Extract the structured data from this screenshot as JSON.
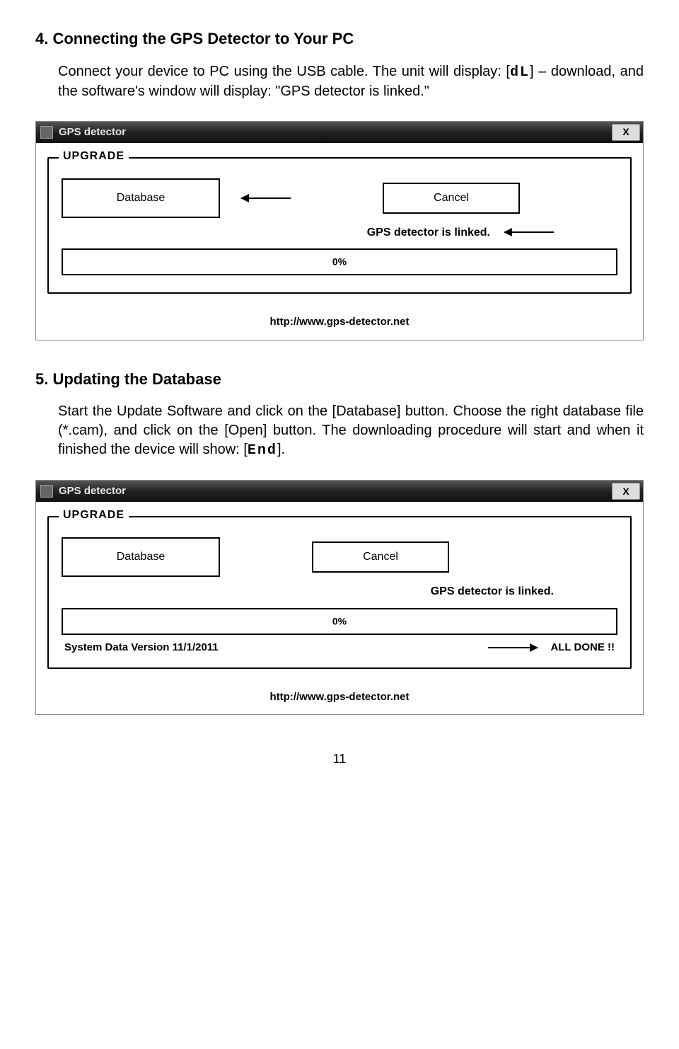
{
  "section4": {
    "title": "4. Connecting the GPS Detector to Your PC",
    "body_part1": "Connect your device to PC using the USB cable. The unit will display: [",
    "seg_dl": "dL",
    "body_part2": "] – download, and the software's window will display: \"GPS detector is linked.\""
  },
  "window1": {
    "title": "GPS detector",
    "close": "X",
    "group_legend": "UPGRADE",
    "database_btn": "Database",
    "cancel_btn": "Cancel",
    "status": "GPS detector is linked.",
    "progress": "0%",
    "url": "http://www.gps-detector.net"
  },
  "section5": {
    "title": "5. Updating the Database",
    "body_part1": "Start the Update Software and click on the [Database] button. Choose the right database file (*.cam), and click on the [Open] button. The downloading procedure will start and when it finished the device will show: [",
    "seg_end": "End",
    "body_part2": "]."
  },
  "window2": {
    "title": "GPS detector",
    "close": "X",
    "group_legend": "UPGRADE",
    "database_btn": "Database",
    "cancel_btn": "Cancel",
    "status": "GPS detector is linked.",
    "progress": "0%",
    "version": "System Data Version 11/1/2011",
    "done": "ALL DONE !!",
    "url": "http://www.gps-detector.net"
  },
  "page_number": "11"
}
